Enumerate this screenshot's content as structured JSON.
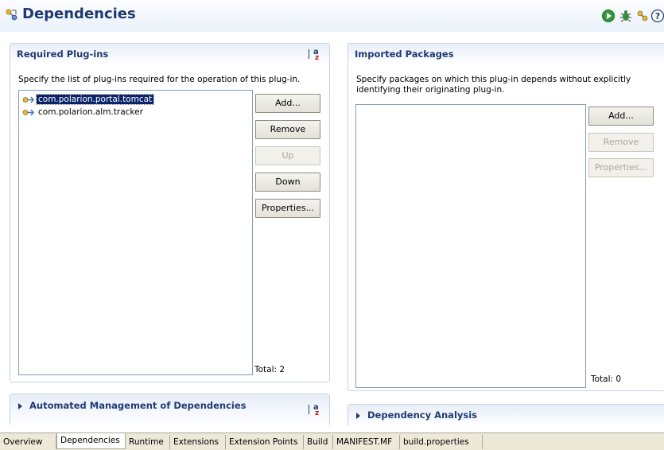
{
  "header": {
    "title": "Dependencies",
    "icons": [
      "dependencies-icon",
      "run-icon",
      "debug-icon",
      "export-icon",
      "help-icon"
    ]
  },
  "required": {
    "title": "Required Plug-ins",
    "description": "Specify the list of plug-ins required for the operation of this plug-in.",
    "items": [
      {
        "label": "com.polarion.portal.tomcat",
        "selected": true
      },
      {
        "label": "com.polarion.alm.tracker",
        "selected": false
      }
    ],
    "buttons": {
      "add": "Add...",
      "remove": "Remove",
      "up": "Up",
      "down": "Down",
      "properties": "Properties..."
    },
    "total": "Total: 2"
  },
  "imported": {
    "title": "Imported Packages",
    "description_line1": "Specify packages on which this plug-in depends without explicitly",
    "description_line2": "identifying their originating plug-in.",
    "buttons": {
      "add": "Add...",
      "remove": "Remove",
      "properties": "Properties..."
    },
    "total": "Total: 0"
  },
  "automated": {
    "title": "Automated Management of Dependencies"
  },
  "analysis": {
    "title": "Dependency Analysis"
  },
  "tabs": [
    "Overview",
    "Dependencies",
    "Runtime",
    "Extensions",
    "Extension Points",
    "Build",
    "MANIFEST.MF",
    "build.properties"
  ],
  "active_tab": "Dependencies",
  "colors": {
    "title": "#1f3a73",
    "selection": "#0a246a",
    "section_border": "#c7d3e3"
  }
}
